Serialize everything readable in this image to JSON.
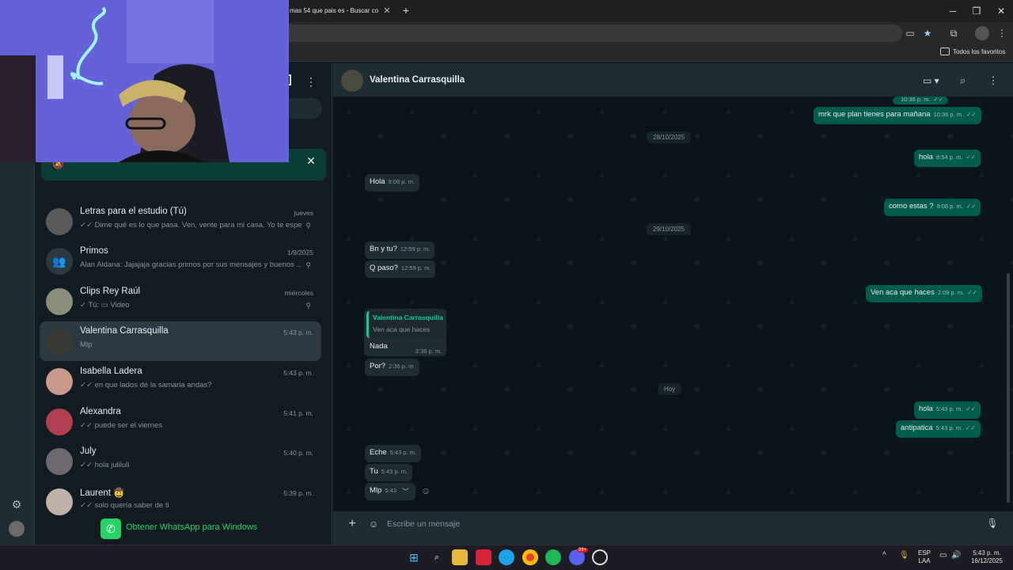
{
  "browser": {
    "tab_title": "mas 54 que pais es - Buscar co",
    "tab_close": "✕",
    "new_tab": "+",
    "window_min": "─",
    "window_max": "❐",
    "window_close": "✕",
    "bookmarks_label": "Todos los favoritos"
  },
  "colors": {
    "accent": "#25d366",
    "outgoing_bubble": "#005c4b",
    "incoming_bubble": "#202c33",
    "read_ticks": "#53bdeb"
  },
  "sidebar": {
    "chats": [
      {
        "name": "Letras para el estudio (Tú)",
        "time": "jueves",
        "ticks": "✓✓",
        "preview": "Dime qué es lo que pasa. Ven, vente para mi casa. Yo te esper...",
        "pinned": true
      },
      {
        "name": "Primos",
        "time": "1/9/2025",
        "ticks": "",
        "preview": "Alan Aldana: Jajajaja gracias primos por sus mensajes y buenos ...",
        "pinned": true
      },
      {
        "name": "Clips Rey Raúl",
        "time": "miércoles",
        "ticks": "✓",
        "preview": "Tú: ▭ Video",
        "pinned": true
      },
      {
        "name": "Valentina Carrasquilla",
        "time": "5:43 p. m.",
        "ticks": "",
        "preview": "Mlp",
        "pinned": false
      },
      {
        "name": "Isabella  Ladera",
        "time": "5:43 p. m.",
        "ticks": "✓✓",
        "preview": "en que lados de la samaria andas?",
        "pinned": false
      },
      {
        "name": "Alexandra",
        "time": "5:41 p. m.",
        "ticks": "✓✓",
        "preview": "puede ser el viernes",
        "pinned": false
      },
      {
        "name": "July",
        "time": "5:40 p. m.",
        "ticks": "✓✓",
        "preview": "hola julilulí",
        "pinned": false
      },
      {
        "name": "Laurent 🤠",
        "time": "5:39 p. m.",
        "ticks": "✓✓",
        "preview": "solo quería saber de ti",
        "pinned": false
      }
    ],
    "get_app": "Obtener WhatsApp para Windows"
  },
  "conversation": {
    "contact": "Valentina Carrasquilla",
    "messages": {
      "m0_time": "10:36 p. m.",
      "m1_text": "mrk que plan tienes para mañana",
      "m1_time": "10:36 p. m.",
      "date1": "28/10/2025",
      "m2_text": "hola",
      "m2_time": "8:54 p. m.",
      "m3_text": "Hola",
      "m3_time": "9:08 p. m.",
      "m4_text": "como estas ?",
      "m4_time": "9:08 p. m.",
      "date2": "29/10/2025",
      "m5_text": "Bn y tu?",
      "m5_time": "12:59 p. m.",
      "m6_text": "Q paso?",
      "m6_time": "12:59 p. m.",
      "m7_text": "Ven aca que haces",
      "m7_time": "2:09 p. m.",
      "reply_name": "Valentina Carrasquilla",
      "reply_quote": "Ven aca que haces",
      "m8_text": "Nada",
      "m8_time": "2:36 p. m.",
      "m9_text": "Por?",
      "m9_time": "2:36 p. m.",
      "date3": "Hoy",
      "m10_text": "hola",
      "m10_time": "5:43 p. m.",
      "m11_text": "antipatica",
      "m11_time": "5:43 p. m.",
      "m12_text": "Eche",
      "m12_time": "5:43 p. m.",
      "m13_text": "Tu",
      "m13_time": "5:43 p. m.",
      "m14_text": "Mlp",
      "m14_time": "5:43"
    },
    "composer_placeholder": "Escribe un mensaje"
  },
  "taskbar": {
    "lang_top": "ESP",
    "lang_bottom": "LAA",
    "time": "5:43 p. m.",
    "date": "16/12/2025",
    "discord_badge": "99+"
  }
}
